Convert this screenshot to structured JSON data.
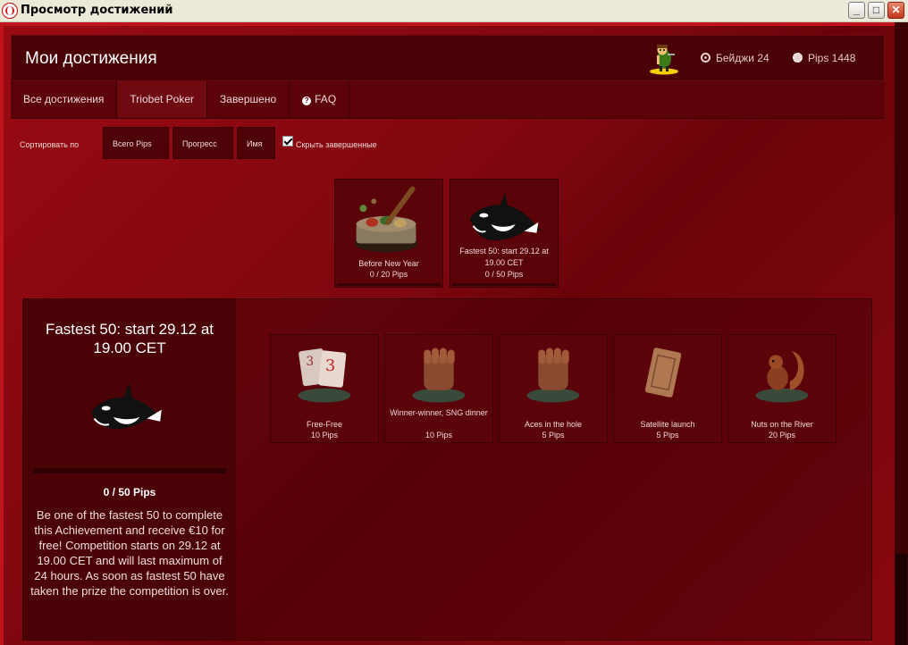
{
  "window": {
    "title": "Просмотр достижений"
  },
  "header": {
    "title": "Мои достижения",
    "badges_label": "Бейджи 24",
    "pips_label": "Pips 1448"
  },
  "tabs": [
    {
      "label": "Все достижения"
    },
    {
      "label": "Triobet Poker"
    },
    {
      "label": "Завершено"
    },
    {
      "label": "FAQ"
    }
  ],
  "sort": {
    "label": "Сортировать по",
    "buttons": [
      "Всего Pips",
      "Прогресс",
      "Имя"
    ],
    "hide_completed_label": "Скрыть завершенные",
    "hide_completed_checked": true
  },
  "top_achievements": [
    {
      "name": "Before New Year",
      "points": "0 / 20 Pips",
      "icon": "chips-pot-icon"
    },
    {
      "name": "Fastest 50: start 29.12 at 19.00 CET",
      "points": "0 / 50 Pips",
      "icon": "orca-icon"
    }
  ],
  "detail": {
    "title": "Fastest 50: start 29.12 at 19.00 CET",
    "pips": "0 / 50 Pips",
    "progress": 0,
    "description": "Be one of the fastest 50 to complete this Achievement and receive €10 for free! Competition starts on 29.12 at 19.00 CET and will last maximum of 24 hours. As soon as fastest 50 have taken the prize the competition is over.",
    "icon": "orca-icon"
  },
  "sub_achievements": [
    {
      "name": "Free-Free",
      "points": "10 Pips",
      "icon": "playing-cards-icon"
    },
    {
      "name": "Winner-winner, SNG dinner",
      "points": "10 Pips",
      "icon": "fist-icon"
    },
    {
      "name": "Aces in the hole",
      "points": "5 Pips",
      "icon": "fist-icon"
    },
    {
      "name": "Satellite launch",
      "points": "5 Pips",
      "icon": "ticket-icon"
    },
    {
      "name": "Nuts on the River",
      "points": "20 Pips",
      "icon": "squirrel-icon"
    }
  ],
  "colors": {
    "background": "#7d0710",
    "panel": "#4a0207",
    "border_accent": "#c0141c",
    "text": "#f0d8d8"
  }
}
